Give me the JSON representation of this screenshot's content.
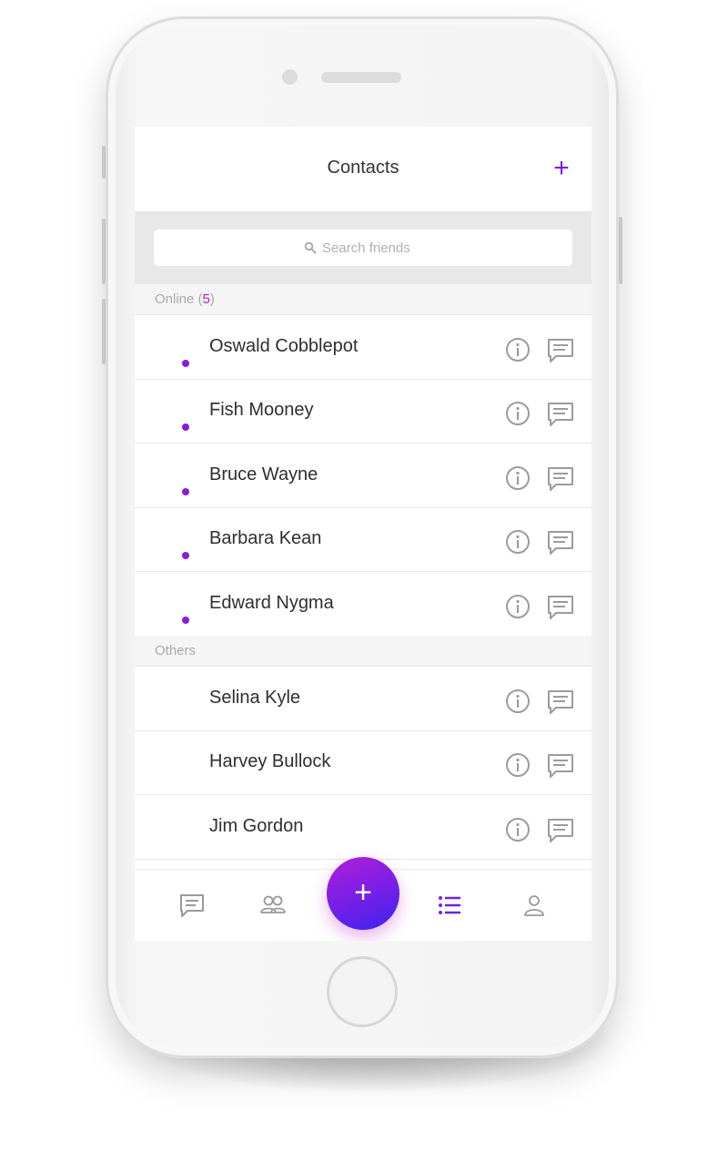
{
  "header": {
    "title": "Contacts",
    "add_icon": "plus-icon"
  },
  "search": {
    "placeholder": "Search friends",
    "icon": "search-icon"
  },
  "sections": {
    "online": {
      "label": "Online",
      "count": "5"
    },
    "others": {
      "label": "Others"
    }
  },
  "online_contacts": [
    {
      "name": "Oswald Cobblepot",
      "status": "online"
    },
    {
      "name": "Fish Mooney",
      "status": "online"
    },
    {
      "name": "Bruce Wayne",
      "status": "online"
    },
    {
      "name": "Barbara Kean",
      "status": "online"
    },
    {
      "name": "Edward Nygma",
      "status": "online"
    }
  ],
  "other_contacts": [
    {
      "name": "Selina Kyle"
    },
    {
      "name": "Harvey Bullock"
    },
    {
      "name": "Jim Gordon"
    }
  ],
  "tabbar": {
    "tabs": [
      {
        "icon": "chat-icon",
        "active": false
      },
      {
        "icon": "group-icon",
        "active": false
      },
      {
        "icon": "list-icon",
        "active": true
      },
      {
        "icon": "profile-icon",
        "active": false
      }
    ],
    "fab_icon": "plus-icon"
  },
  "colors": {
    "accent": "#7b1fe8",
    "online_dot": "#8a1cd8",
    "count": "#b01ec8",
    "fab_start": "#b11fd6",
    "fab_end": "#3d24ee"
  }
}
